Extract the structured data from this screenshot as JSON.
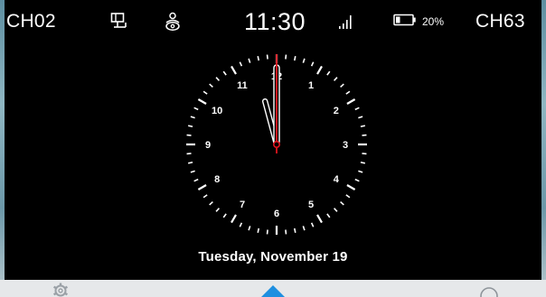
{
  "status_bar": {
    "left_channel": "CH02",
    "time": "11:30",
    "battery_percent": "20%",
    "right_channel": "CH63",
    "icons": [
      "monitor-icon",
      "person-icon",
      "signal-icon",
      "battery-icon"
    ]
  },
  "clock": {
    "hour": 11,
    "minute": 30,
    "second": 0,
    "numerals": [
      "12",
      "1",
      "2",
      "3",
      "4",
      "5",
      "6",
      "7",
      "8",
      "9",
      "10",
      "11"
    ],
    "second_hand_color": "#e0141e",
    "face_color": "#ffffff"
  },
  "date_text": "Tuesday, November 19",
  "bottom_bar": {
    "icons": [
      "settings-icon",
      "home-icon",
      "search-icon"
    ],
    "active_color": "#1e8fe0"
  }
}
